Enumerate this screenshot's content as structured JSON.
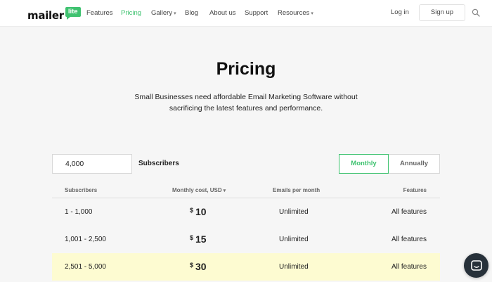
{
  "nav": {
    "logo_word": "mailer",
    "logo_badge": "lite",
    "menu": [
      {
        "label": "Features"
      },
      {
        "label": "Pricing"
      },
      {
        "label": "Gallery"
      },
      {
        "label": "Blog"
      },
      {
        "label": "About us"
      },
      {
        "label": "Support"
      },
      {
        "label": "Resources"
      }
    ],
    "login": "Log in",
    "signup": "Sign up"
  },
  "hero": {
    "title": "Pricing",
    "subtitle_line1": "Small Businesses need affordable Email Marketing Software without",
    "subtitle_line2": "sacrificing the latest features and performance."
  },
  "controls": {
    "subscribers_value": "4,000",
    "subscribers_label": "Subscribers",
    "monthly_label": "Monthly",
    "annually_label": "Annually"
  },
  "table": {
    "headers": {
      "subscribers": "Subscribers",
      "cost": "Monthly cost, USD",
      "emails": "Emails per month",
      "features": "Features"
    },
    "rows": [
      {
        "subscribers": "1 - 1,000",
        "currency": "$",
        "price": "10",
        "emails": "Unlimited",
        "features": "All features"
      },
      {
        "subscribers": "1,001 - 2,500",
        "currency": "$",
        "price": "15",
        "emails": "Unlimited",
        "features": "All features"
      },
      {
        "subscribers": "2,501 - 5,000",
        "currency": "$",
        "price": "30",
        "emails": "Unlimited",
        "features": "All features"
      }
    ]
  },
  "colors": {
    "accent": "#3ec26f",
    "highlight_row": "#fdfbd1",
    "chat_button": "#27313a"
  },
  "icons": {
    "search": "search-icon",
    "chat": "chat-icon",
    "caret": "chevron-down-icon"
  }
}
